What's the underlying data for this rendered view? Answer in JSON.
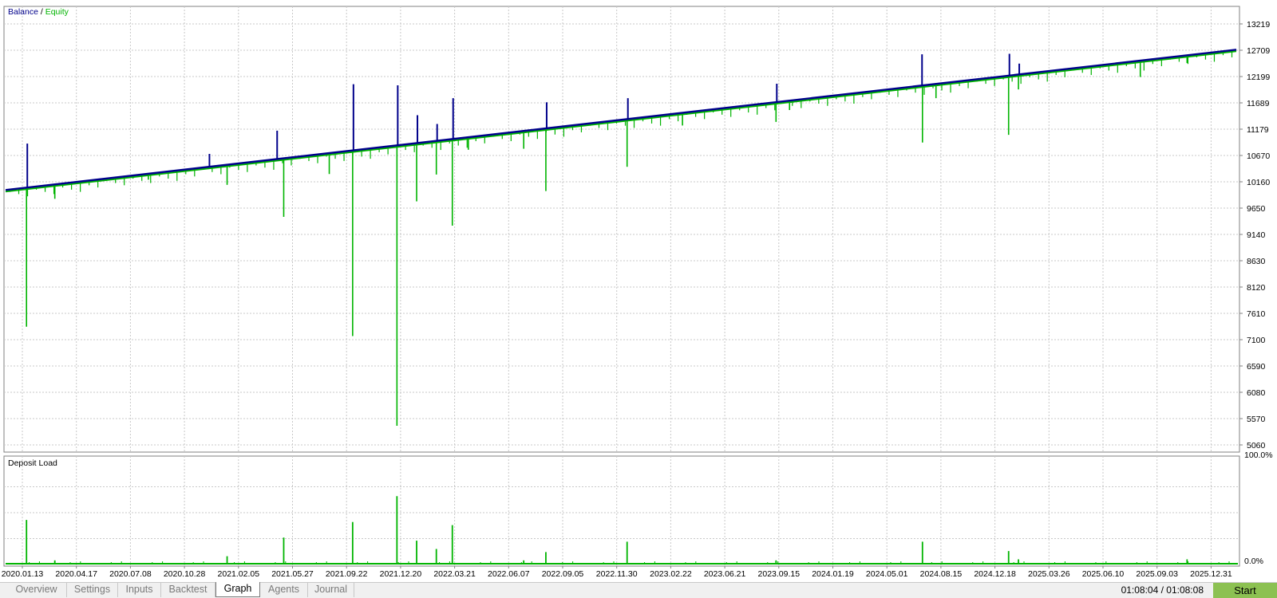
{
  "chart_data": [
    {
      "type": "line",
      "legend": [
        {
          "name": "Balance",
          "color": "#00008b"
        },
        {
          "name": "Equity",
          "color": "#00b400"
        }
      ],
      "legend_separator": "/",
      "legend_placement": "top-left",
      "grid": true,
      "ylim": [
        5060,
        13219
      ],
      "y_ticks": [
        "13219",
        "12709",
        "12199",
        "11689",
        "11179",
        "10670",
        "10160",
        "9650",
        "9140",
        "8630",
        "8120",
        "7610",
        "7100",
        "6590",
        "6080",
        "5570",
        "5060"
      ],
      "x_ticks": [
        "2020.01.13",
        "2020.04.17",
        "2020.07.08",
        "2020.10.28",
        "2021.02.05",
        "2021.05.27",
        "2021.09.22",
        "2021.12.20",
        "2022.03.21",
        "2022.06.07",
        "2022.09.05",
        "2022.11.30",
        "2023.02.22",
        "2023.06.21",
        "2023.09.15",
        "2024.01.19",
        "2024.05.01",
        "2024.08.15",
        "2024.12.18",
        "2025.03.26",
        "2025.06.10",
        "2025.09.03",
        "2025.12.31"
      ],
      "balance_start": 10000,
      "balance_end": 12720,
      "balance_spikes": [
        {
          "x": 0.017,
          "y": 10900
        },
        {
          "x": 0.165,
          "y": 10700
        },
        {
          "x": 0.22,
          "y": 11150
        },
        {
          "x": 0.282,
          "y": 12050
        },
        {
          "x": 0.318,
          "y": 12030
        },
        {
          "x": 0.334,
          "y": 11450
        },
        {
          "x": 0.35,
          "y": 11280
        },
        {
          "x": 0.363,
          "y": 11780
        },
        {
          "x": 0.439,
          "y": 11700
        },
        {
          "x": 0.505,
          "y": 11780
        },
        {
          "x": 0.626,
          "y": 12060
        },
        {
          "x": 0.744,
          "y": 12630
        },
        {
          "x": 0.815,
          "y": 12640
        },
        {
          "x": 0.823,
          "y": 12450
        }
      ],
      "equity_drawdowns": [
        {
          "x": 0.017,
          "y": 7350
        },
        {
          "x": 0.04,
          "y": 9830
        },
        {
          "x": 0.116,
          "y": 10200
        },
        {
          "x": 0.18,
          "y": 10100
        },
        {
          "x": 0.226,
          "y": 9480
        },
        {
          "x": 0.263,
          "y": 10310
        },
        {
          "x": 0.282,
          "y": 7170
        },
        {
          "x": 0.318,
          "y": 5430
        },
        {
          "x": 0.334,
          "y": 9780
        },
        {
          "x": 0.35,
          "y": 10300
        },
        {
          "x": 0.363,
          "y": 9310
        },
        {
          "x": 0.376,
          "y": 10780
        },
        {
          "x": 0.421,
          "y": 10800
        },
        {
          "x": 0.439,
          "y": 9980
        },
        {
          "x": 0.505,
          "y": 10450
        },
        {
          "x": 0.55,
          "y": 11250
        },
        {
          "x": 0.626,
          "y": 11320
        },
        {
          "x": 0.637,
          "y": 11550
        },
        {
          "x": 0.745,
          "y": 10920
        },
        {
          "x": 0.756,
          "y": 11780
        },
        {
          "x": 0.815,
          "y": 11070
        },
        {
          "x": 0.823,
          "y": 11950
        },
        {
          "x": 0.922,
          "y": 12190
        },
        {
          "x": 0.96,
          "y": 12460
        }
      ]
    },
    {
      "type": "bar",
      "title": "Deposit Load",
      "ylim": [
        0,
        100
      ],
      "y_ticks": [
        "100.0%",
        "0.0%"
      ],
      "spikes": [
        {
          "x": 0.017,
          "y": 43
        },
        {
          "x": 0.04,
          "y": 4
        },
        {
          "x": 0.18,
          "y": 8
        },
        {
          "x": 0.226,
          "y": 26
        },
        {
          "x": 0.282,
          "y": 41
        },
        {
          "x": 0.318,
          "y": 66
        },
        {
          "x": 0.334,
          "y": 23
        },
        {
          "x": 0.35,
          "y": 15
        },
        {
          "x": 0.363,
          "y": 38
        },
        {
          "x": 0.421,
          "y": 4
        },
        {
          "x": 0.439,
          "y": 12
        },
        {
          "x": 0.505,
          "y": 22
        },
        {
          "x": 0.626,
          "y": 4
        },
        {
          "x": 0.745,
          "y": 22
        },
        {
          "x": 0.815,
          "y": 13
        },
        {
          "x": 0.823,
          "y": 5
        },
        {
          "x": 0.96,
          "y": 5
        }
      ]
    }
  ],
  "tabs": [
    {
      "label": "Overview",
      "active": false
    },
    {
      "label": "Settings",
      "active": false
    },
    {
      "label": "Inputs",
      "active": false
    },
    {
      "label": "Backtest",
      "active": false
    },
    {
      "label": "Graph",
      "active": true
    },
    {
      "label": "Agents",
      "active": false
    },
    {
      "label": "Journal",
      "active": false
    }
  ],
  "timer": "01:08:04 / 01:08:08",
  "start_label": "Start",
  "colors": {
    "balance": "#00008b",
    "equity": "#00b400",
    "start_button": "#8cc152",
    "grid": "#c8c8c8"
  }
}
